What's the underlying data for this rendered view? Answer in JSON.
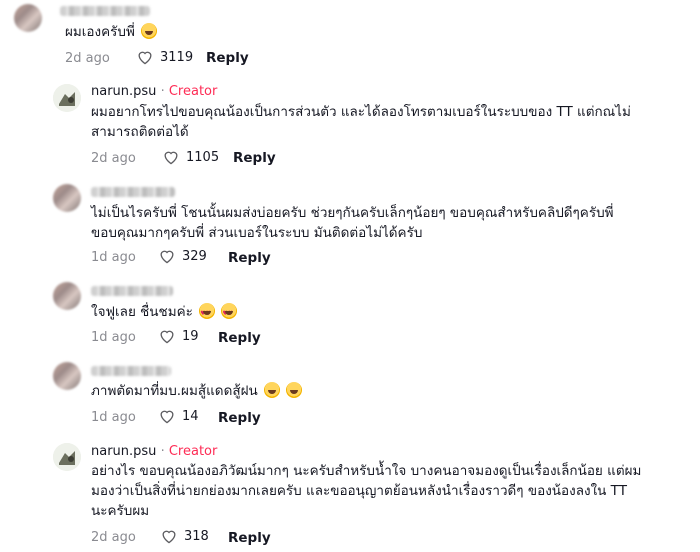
{
  "comments": [
    {
      "text_lines": [
        "ผมเองครับพี่"
      ],
      "emoji": [
        "grinning-emoji"
      ],
      "date": "2d ago",
      "likes": "3119",
      "reply_label": "Reply"
    },
    {
      "username": "narun.psu",
      "separator": "·",
      "creator_label": "Creator",
      "text_lines": [
        "ผมอยากโทรไปขอบคุณน้องเป็นการส่วนตัว และได้ลองโทรตามเบอร์ในระบบของ TT แต่กณไม่",
        "สามารถติดต่อได้"
      ],
      "date": "2d ago",
      "likes": "1105",
      "reply_label": "Reply"
    },
    {
      "text_lines": [
        "ไม่เป็นไรครับพี่ โชนนั้นผมส่งบ่อยครับ ช่วยๆกันครับเล็กๆน้อยๆ ขอบคุณสำหรับคลิปดีๆครับพี่",
        "ขอบคุณมากๆครับพี่ ส่วนเบอร์ในระบบ มันติดต่อไม่ได้ครับ"
      ],
      "date": "1d ago",
      "likes": "329",
      "reply_label": "Reply"
    },
    {
      "text_lines": [
        "ใจฟูเลย ชื่นชมค่ะ"
      ],
      "emoji": [
        "smiling-hearts-emoji",
        "smiling-hearts-emoji"
      ],
      "date": "1d ago",
      "likes": "19",
      "reply_label": "Reply"
    },
    {
      "text_lines": [
        "ภาพตัดมาที่มบ.ผมสู้แดดสู้ฝน"
      ],
      "emoji": [
        "grinning-emoji",
        "grinning-emoji"
      ],
      "date": "1d ago",
      "likes": "14",
      "reply_label": "Reply"
    },
    {
      "username": "narun.psu",
      "separator": "·",
      "creator_label": "Creator",
      "text_lines": [
        "อย่างไร ขอบคุณน้องอภิวัฒน์มากๆ นะครับสำหรับน้ำใจ บางคนอาจมองดูเป็นเรื่องเล็กน้อย แต่ผม",
        "มองว่าเป็นสิ่งที่น่ายกย่องมากเลยครับ และขออนุญาตย้อนหลังนำเรื่องราวดีๆ ของน้องลงใน TT",
        "นะครับผม"
      ],
      "date": "2d ago",
      "likes": "318",
      "reply_label": "Reply"
    }
  ]
}
